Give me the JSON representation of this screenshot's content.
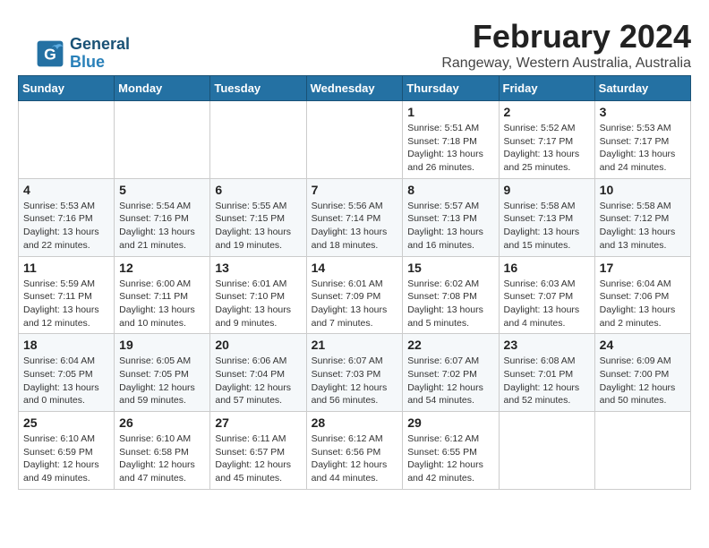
{
  "logo": {
    "line1": "General",
    "line2": "Blue"
  },
  "header": {
    "month_year": "February 2024",
    "location": "Rangeway, Western Australia, Australia"
  },
  "days_of_week": [
    "Sunday",
    "Monday",
    "Tuesday",
    "Wednesday",
    "Thursday",
    "Friday",
    "Saturday"
  ],
  "weeks": [
    [
      {
        "day": "",
        "info": ""
      },
      {
        "day": "",
        "info": ""
      },
      {
        "day": "",
        "info": ""
      },
      {
        "day": "",
        "info": ""
      },
      {
        "day": "1",
        "info": "Sunrise: 5:51 AM\nSunset: 7:18 PM\nDaylight: 13 hours\nand 26 minutes."
      },
      {
        "day": "2",
        "info": "Sunrise: 5:52 AM\nSunset: 7:17 PM\nDaylight: 13 hours\nand 25 minutes."
      },
      {
        "day": "3",
        "info": "Sunrise: 5:53 AM\nSunset: 7:17 PM\nDaylight: 13 hours\nand 24 minutes."
      }
    ],
    [
      {
        "day": "4",
        "info": "Sunrise: 5:53 AM\nSunset: 7:16 PM\nDaylight: 13 hours\nand 22 minutes."
      },
      {
        "day": "5",
        "info": "Sunrise: 5:54 AM\nSunset: 7:16 PM\nDaylight: 13 hours\nand 21 minutes."
      },
      {
        "day": "6",
        "info": "Sunrise: 5:55 AM\nSunset: 7:15 PM\nDaylight: 13 hours\nand 19 minutes."
      },
      {
        "day": "7",
        "info": "Sunrise: 5:56 AM\nSunset: 7:14 PM\nDaylight: 13 hours\nand 18 minutes."
      },
      {
        "day": "8",
        "info": "Sunrise: 5:57 AM\nSunset: 7:13 PM\nDaylight: 13 hours\nand 16 minutes."
      },
      {
        "day": "9",
        "info": "Sunrise: 5:58 AM\nSunset: 7:13 PM\nDaylight: 13 hours\nand 15 minutes."
      },
      {
        "day": "10",
        "info": "Sunrise: 5:58 AM\nSunset: 7:12 PM\nDaylight: 13 hours\nand 13 minutes."
      }
    ],
    [
      {
        "day": "11",
        "info": "Sunrise: 5:59 AM\nSunset: 7:11 PM\nDaylight: 13 hours\nand 12 minutes."
      },
      {
        "day": "12",
        "info": "Sunrise: 6:00 AM\nSunset: 7:11 PM\nDaylight: 13 hours\nand 10 minutes."
      },
      {
        "day": "13",
        "info": "Sunrise: 6:01 AM\nSunset: 7:10 PM\nDaylight: 13 hours\nand 9 minutes."
      },
      {
        "day": "14",
        "info": "Sunrise: 6:01 AM\nSunset: 7:09 PM\nDaylight: 13 hours\nand 7 minutes."
      },
      {
        "day": "15",
        "info": "Sunrise: 6:02 AM\nSunset: 7:08 PM\nDaylight: 13 hours\nand 5 minutes."
      },
      {
        "day": "16",
        "info": "Sunrise: 6:03 AM\nSunset: 7:07 PM\nDaylight: 13 hours\nand 4 minutes."
      },
      {
        "day": "17",
        "info": "Sunrise: 6:04 AM\nSunset: 7:06 PM\nDaylight: 13 hours\nand 2 minutes."
      }
    ],
    [
      {
        "day": "18",
        "info": "Sunrise: 6:04 AM\nSunset: 7:05 PM\nDaylight: 13 hours\nand 0 minutes."
      },
      {
        "day": "19",
        "info": "Sunrise: 6:05 AM\nSunset: 7:05 PM\nDaylight: 12 hours\nand 59 minutes."
      },
      {
        "day": "20",
        "info": "Sunrise: 6:06 AM\nSunset: 7:04 PM\nDaylight: 12 hours\nand 57 minutes."
      },
      {
        "day": "21",
        "info": "Sunrise: 6:07 AM\nSunset: 7:03 PM\nDaylight: 12 hours\nand 56 minutes."
      },
      {
        "day": "22",
        "info": "Sunrise: 6:07 AM\nSunset: 7:02 PM\nDaylight: 12 hours\nand 54 minutes."
      },
      {
        "day": "23",
        "info": "Sunrise: 6:08 AM\nSunset: 7:01 PM\nDaylight: 12 hours\nand 52 minutes."
      },
      {
        "day": "24",
        "info": "Sunrise: 6:09 AM\nSunset: 7:00 PM\nDaylight: 12 hours\nand 50 minutes."
      }
    ],
    [
      {
        "day": "25",
        "info": "Sunrise: 6:10 AM\nSunset: 6:59 PM\nDaylight: 12 hours\nand 49 minutes."
      },
      {
        "day": "26",
        "info": "Sunrise: 6:10 AM\nSunset: 6:58 PM\nDaylight: 12 hours\nand 47 minutes."
      },
      {
        "day": "27",
        "info": "Sunrise: 6:11 AM\nSunset: 6:57 PM\nDaylight: 12 hours\nand 45 minutes."
      },
      {
        "day": "28",
        "info": "Sunrise: 6:12 AM\nSunset: 6:56 PM\nDaylight: 12 hours\nand 44 minutes."
      },
      {
        "day": "29",
        "info": "Sunrise: 6:12 AM\nSunset: 6:55 PM\nDaylight: 12 hours\nand 42 minutes."
      },
      {
        "day": "",
        "info": ""
      },
      {
        "day": "",
        "info": ""
      }
    ]
  ]
}
